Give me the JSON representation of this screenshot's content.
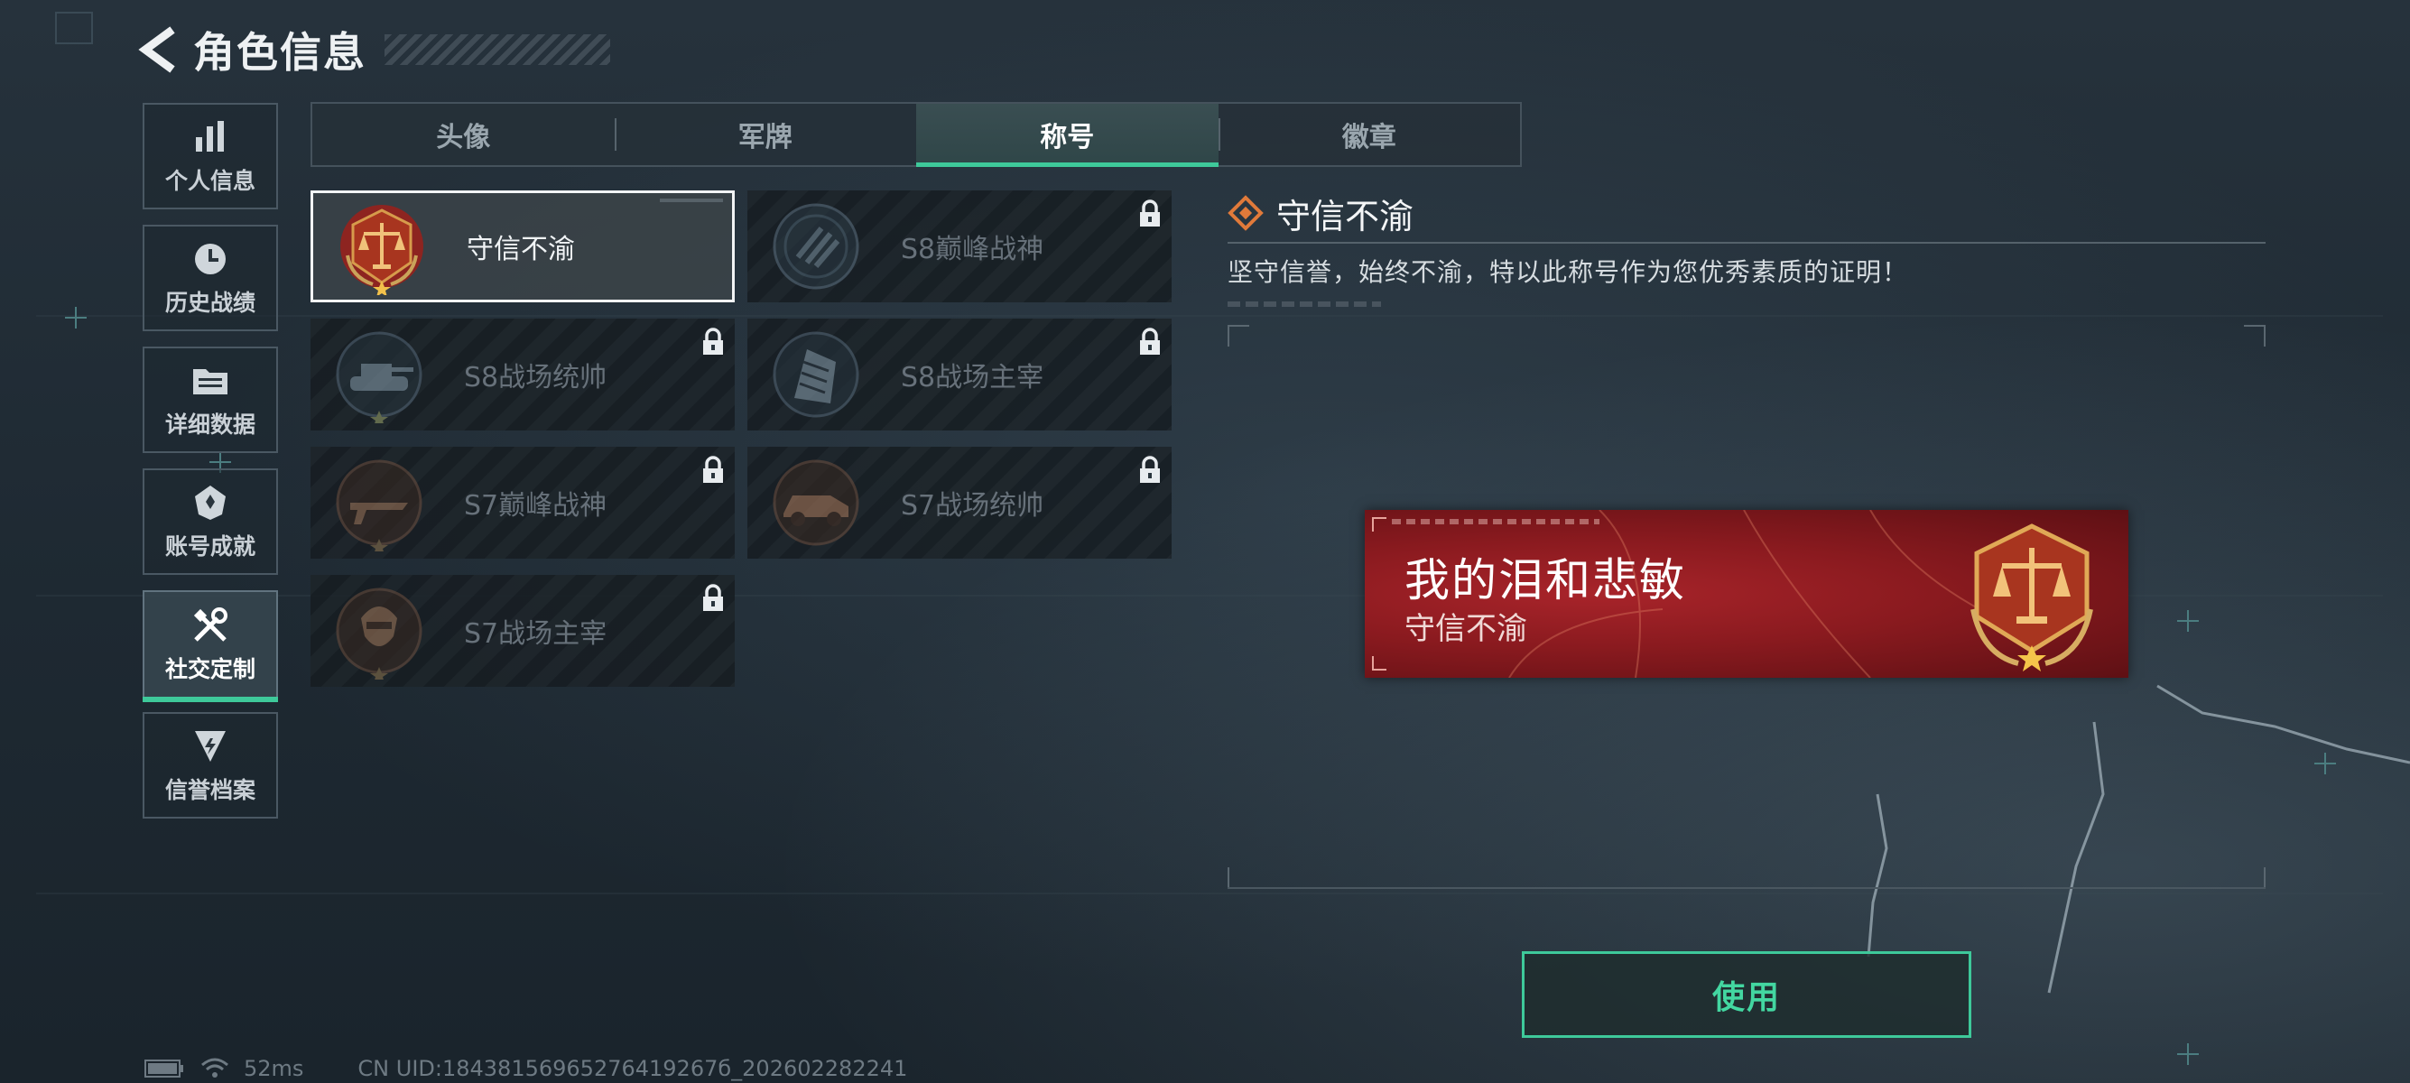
{
  "header": {
    "title": "角色信息"
  },
  "sidebar": {
    "items": [
      {
        "label": "个人信息",
        "icon": "bar-chart-icon",
        "active": false
      },
      {
        "label": "历史战绩",
        "icon": "clock-history-icon",
        "active": false
      },
      {
        "label": "详细数据",
        "icon": "folder-icon",
        "active": false
      },
      {
        "label": "账号成就",
        "icon": "achievement-badge-icon",
        "active": false
      },
      {
        "label": "社交定制",
        "icon": "tools-wrench-icon",
        "active": true
      },
      {
        "label": "信誉档案",
        "icon": "shield-credit-icon",
        "active": false
      }
    ]
  },
  "tabs": [
    {
      "label": "头像",
      "active": false
    },
    {
      "label": "军牌",
      "active": false
    },
    {
      "label": "称号",
      "active": true
    },
    {
      "label": "徽章",
      "active": false
    }
  ],
  "titles": [
    {
      "name": "守信不渝",
      "badge": "scales-badge-icon",
      "locked": false,
      "selected": true
    },
    {
      "name": "S8巅峰战神",
      "badge": "s8-peak-badge-icon",
      "locked": true,
      "selected": false
    },
    {
      "name": "S8战场统帅",
      "badge": "tank-badge-icon",
      "locked": true,
      "selected": false
    },
    {
      "name": "S8战场主宰",
      "badge": "building-badge-icon",
      "locked": true,
      "selected": false
    },
    {
      "name": "S7巅峰战神",
      "badge": "rifle-badge-icon",
      "locked": true,
      "selected": false
    },
    {
      "name": "S7战场统帅",
      "badge": "vehicle-badge-icon",
      "locked": true,
      "selected": false
    },
    {
      "name": "S7战场主宰",
      "badge": "soldier-badge-icon",
      "locked": true,
      "selected": false
    }
  ],
  "detail": {
    "title": "守信不渝",
    "description": "坚守信誉，始终不渝，特以此称号作为您优秀素质的证明！"
  },
  "nameplate": {
    "player_name": "我的泪和悲敏",
    "title": "守信不渝"
  },
  "use_button": {
    "label": "使用"
  },
  "status": {
    "ping": "52ms",
    "uid": "CN UID:18438156965276419267б_202602282241"
  },
  "colors": {
    "accent": "#3ec99a",
    "nameplate_red": "#8a1a1f",
    "diamond_orange": "#e07a3a"
  }
}
